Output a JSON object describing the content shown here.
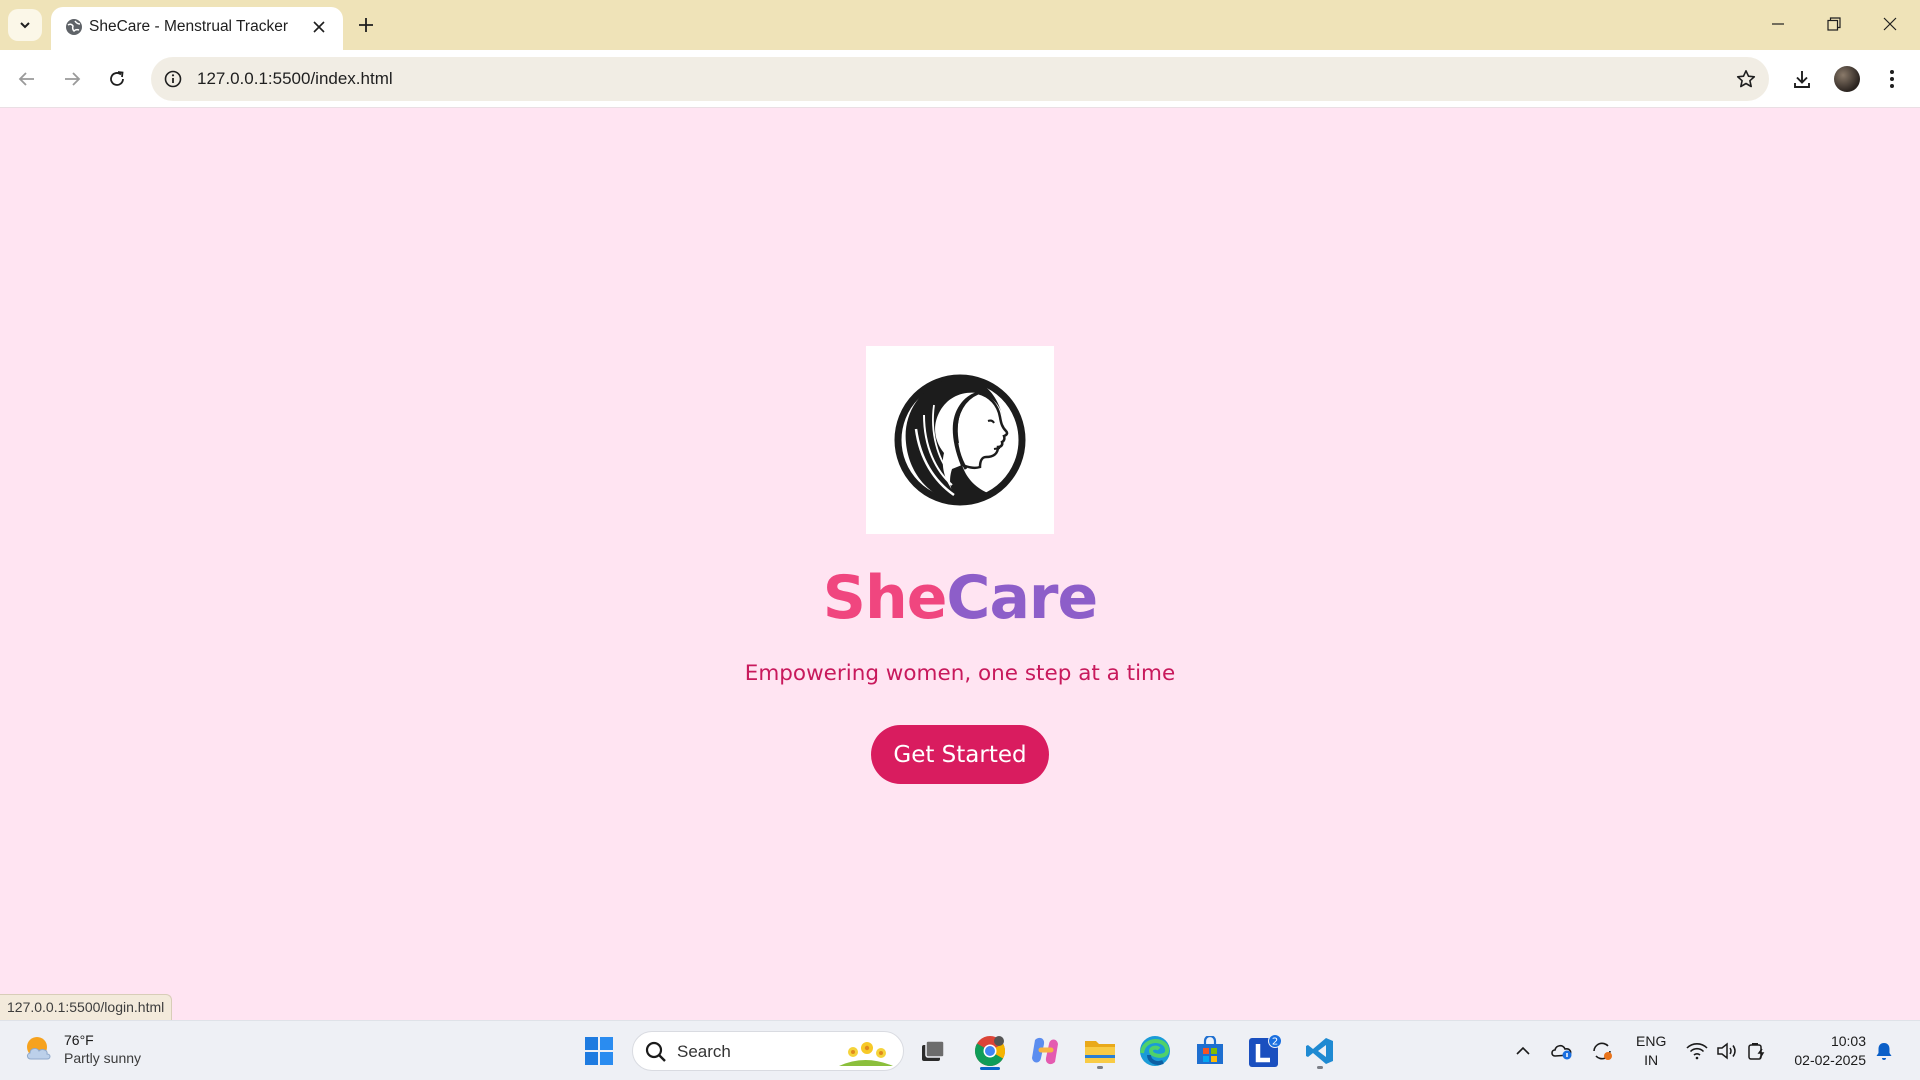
{
  "browser": {
    "tab_title": "SheCare - Menstrual Tracker",
    "url": "127.0.0.1:5500/index.html",
    "status_url": "127.0.0.1:5500/login.html"
  },
  "page": {
    "brand_she": "She",
    "brand_care": "Care",
    "tagline": "Empowering women, one step at a time",
    "cta_label": "Get Started"
  },
  "taskbar": {
    "weather_temp": "76°F",
    "weather_desc": "Partly sunny",
    "search_placeholder": "Search",
    "lang_line1": "ENG",
    "lang_line2": "IN",
    "time": "10:03",
    "date": "02-02-2025",
    "badge_count": "2"
  },
  "colors": {
    "page_bg": "#ffe4f2",
    "brand_pink": "#f0467f",
    "brand_purple": "#8d5ec9",
    "tagline": "#c8195c",
    "cta_bg": "#d91c5f",
    "tabstrip_bg": "#efe3b8"
  },
  "icons": [
    "tab-search-icon",
    "globe-icon",
    "close-icon",
    "plus-icon",
    "minimize-icon",
    "restore-icon",
    "back-icon",
    "forward-icon",
    "reload-icon",
    "info-icon",
    "star-icon",
    "download-icon",
    "kebab-menu-icon",
    "weather-icon",
    "windows-start-icon",
    "search-icon",
    "task-view-icon",
    "chrome-icon",
    "copilot-icon",
    "file-explorer-icon",
    "edge-icon",
    "store-icon",
    "vscode-icon",
    "chevron-up-icon",
    "onedrive-icon",
    "sync-icon",
    "wifi-icon",
    "volume-icon",
    "battery-icon",
    "bell-icon"
  ]
}
